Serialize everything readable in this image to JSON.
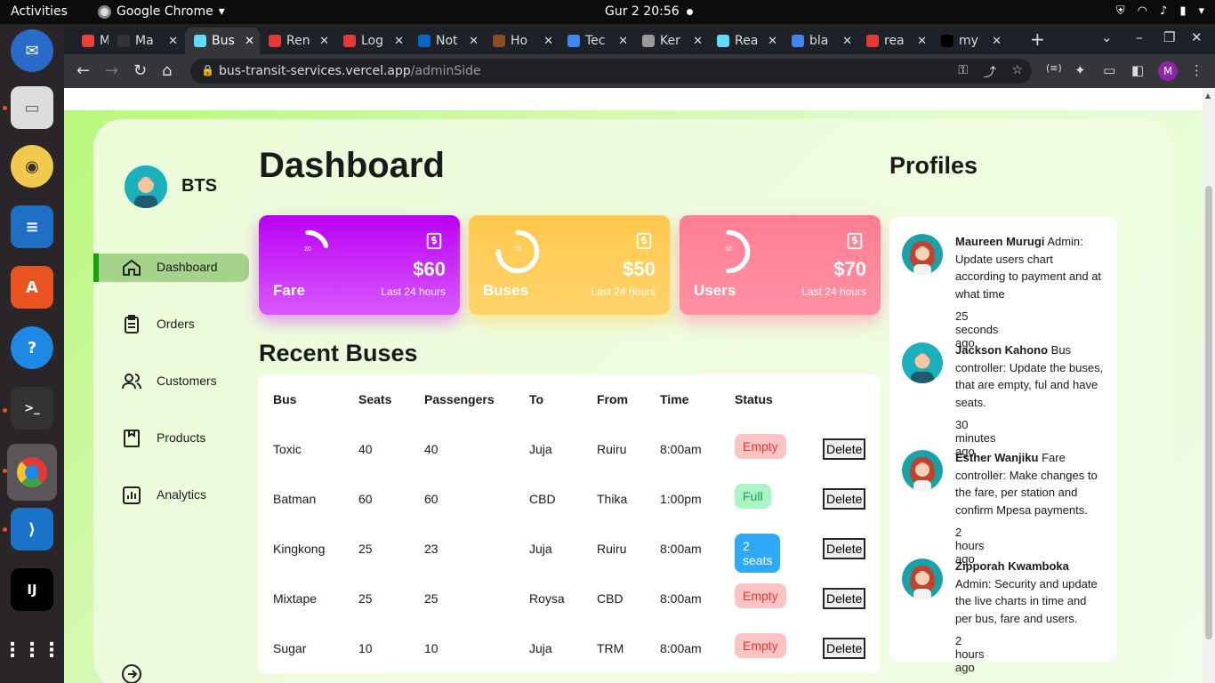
{
  "topbar": {
    "activities": "Activities",
    "app_name": "Google Chrome",
    "clock": "Gur 2  20:56"
  },
  "browser": {
    "tabs": [
      {
        "label": "M",
        "favicon": "gmail-icon",
        "color": "#ea4335"
      },
      {
        "label": "Ma",
        "favicon": "github-icon",
        "color": "#333"
      },
      {
        "label": "Bus",
        "favicon": "react-icon",
        "color": "#61dafb",
        "active": true
      },
      {
        "label": "Ren",
        "favicon": "ok-icon",
        "color": "#e53935"
      },
      {
        "label": "Log",
        "favicon": "ok-icon",
        "color": "#e53935"
      },
      {
        "label": "Not",
        "favicon": "linkedin-icon",
        "color": "#0a66c2"
      },
      {
        "label": "Ho",
        "favicon": "tree-icon",
        "color": "#8d4c2a"
      },
      {
        "label": "Tec",
        "favicon": "docs-icon",
        "color": "#4285f4"
      },
      {
        "label": "Ker",
        "favicon": "globe-icon",
        "color": "#999"
      },
      {
        "label": "Rea",
        "favicon": "react-icon",
        "color": "#61dafb"
      },
      {
        "label": "bla",
        "favicon": "google-icon",
        "color": "#4285f4"
      },
      {
        "label": "rea",
        "favicon": "bookmark-icon",
        "color": "#e53935"
      },
      {
        "label": "my",
        "favicon": "triangle-icon",
        "color": "#000"
      }
    ],
    "url_host": "bus-transit-services.vercel.app",
    "url_path": "/adminSide",
    "profile_initial": "M"
  },
  "sidebar": {
    "brand": "BTS",
    "items": [
      {
        "label": "Dashboard",
        "icon": "home-icon",
        "active": true
      },
      {
        "label": "Orders",
        "icon": "clipboard-icon"
      },
      {
        "label": "Customers",
        "icon": "users-icon"
      },
      {
        "label": "Products",
        "icon": "box-icon"
      },
      {
        "label": "Analytics",
        "icon": "chart-icon"
      }
    ]
  },
  "main": {
    "title": "Dashboard",
    "stats": [
      {
        "name": "Fare",
        "value": "$60",
        "sub": "Last 24 hours",
        "ring_label": "20",
        "progress": 0.2,
        "color_from": "#b900f2",
        "color_to": "#d959ff"
      },
      {
        "name": "Buses",
        "value": "$50",
        "sub": "Last 24 hours",
        "ring_label": "75",
        "progress": 0.75,
        "color_from": "#ffc94d",
        "color_to": "#ffd36b"
      },
      {
        "name": "Users",
        "value": "$70",
        "sub": "Last 24 hours",
        "ring_label": "50",
        "progress": 0.5,
        "color_from": "#ff7d94",
        "color_to": "#ff91a4"
      }
    ],
    "recent_title": "Recent Buses",
    "table": {
      "headers": [
        "Bus",
        "Seats",
        "Passengers",
        "To",
        "From",
        "Time",
        "Status"
      ],
      "rows": [
        {
          "bus": "Toxic",
          "seats": "40",
          "passengers": "40",
          "to": "Juja",
          "from": "Ruiru",
          "time": "8:00am",
          "status": "Empty",
          "status_kind": "empty"
        },
        {
          "bus": "Batman",
          "seats": "60",
          "passengers": "60",
          "to": "CBD",
          "from": "Thika",
          "time": "1:00pm",
          "status": "Full",
          "status_kind": "full"
        },
        {
          "bus": "Kingkong",
          "seats": "25",
          "passengers": "23",
          "to": "Juja",
          "from": "Ruiru",
          "time": "8:00am",
          "status": "2 seats",
          "status_kind": "seats"
        },
        {
          "bus": "Mixtape",
          "seats": "25",
          "passengers": "25",
          "to": "Roysa",
          "from": "CBD",
          "time": "8:00am",
          "status": "Empty",
          "status_kind": "empty"
        },
        {
          "bus": "Sugar",
          "seats": "10",
          "passengers": "10",
          "to": "Juja",
          "from": "TRM",
          "time": "8:00am",
          "status": "Empty",
          "status_kind": "empty"
        }
      ],
      "delete_label": "Delete"
    }
  },
  "profiles": {
    "title": "Profiles",
    "items": [
      {
        "name": "Maureen Murugi",
        "text": "Admin: Update users chart according to payment and at what time",
        "time": "25 seconds ago",
        "avatar": "female"
      },
      {
        "name": "Jackson Kahono",
        "text": "Bus controller: Update the buses, that are empty, ful and have seats.",
        "time": "30 minutes ago",
        "avatar": "male"
      },
      {
        "name": "Esther Wanjiku",
        "text": "Fare controller: Make changes to the fare, per station and confirm Mpesa payments.",
        "time": "2 hours ago",
        "avatar": "female"
      },
      {
        "name": "Zipporah Kwamboka",
        "text": "Admin: Security and update the live charts in time and per bus, fare and users.",
        "time": "2 hours ago",
        "avatar": "female"
      }
    ]
  },
  "colors": {
    "empty_bg": "#fbc3c3",
    "empty_fg": "#e53935",
    "full_bg": "#a9f5c6",
    "full_fg": "#18a349",
    "seats_bg": "#2fa8f5",
    "seats_fg": "#ffffff"
  }
}
